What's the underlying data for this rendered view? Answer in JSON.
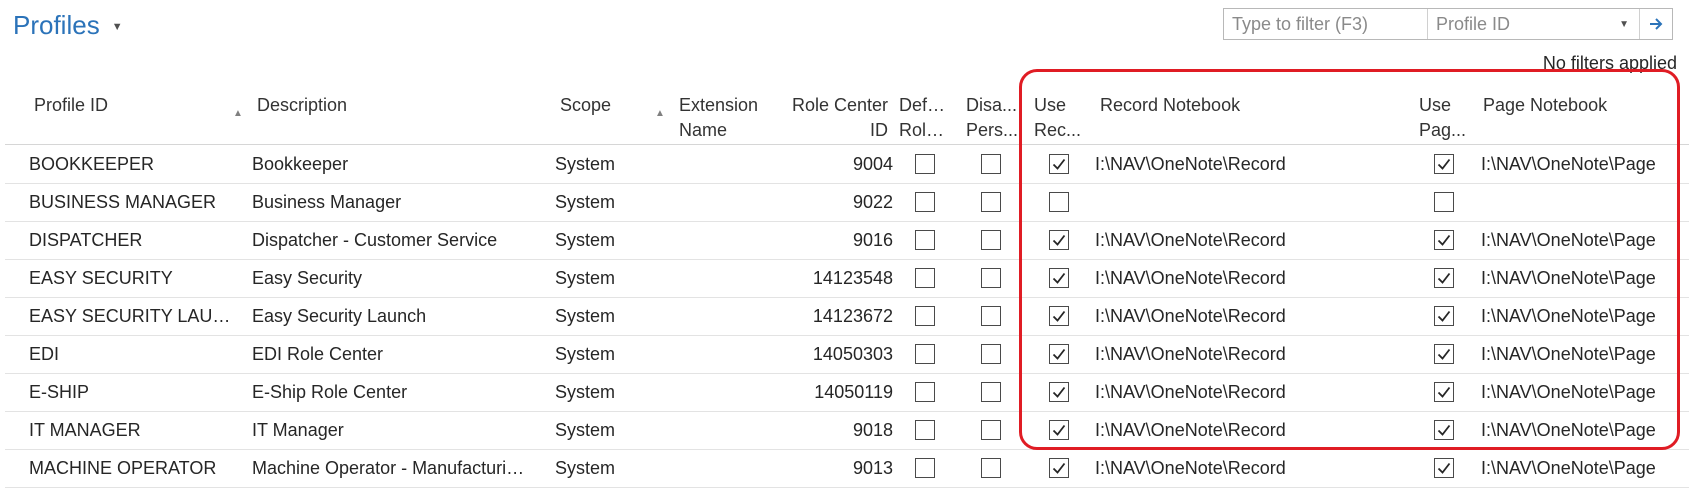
{
  "page": {
    "title": "Profiles",
    "filter": {
      "placeholder": "Type to filter (F3)",
      "field": "Profile ID",
      "status": "No filters applied"
    }
  },
  "columns": [
    {
      "key": "profile_id",
      "label": "Profile ID"
    },
    {
      "key": "description",
      "label": "Description"
    },
    {
      "key": "scope",
      "label": "Scope"
    },
    {
      "key": "extension_name",
      "label": "Extension Name"
    },
    {
      "key": "role_center_id",
      "label": "Role Center ID"
    },
    {
      "key": "default_role",
      "label": "Defa... Role..."
    },
    {
      "key": "disable_pers",
      "label": "Disa... Pers..."
    },
    {
      "key": "use_record",
      "label": "Use Rec..."
    },
    {
      "key": "record_notebook",
      "label": "Record Notebook"
    },
    {
      "key": "use_page",
      "label": "Use Pag..."
    },
    {
      "key": "page_notebook",
      "label": "Page Notebook"
    }
  ],
  "column_header_lines": {
    "profile_id": [
      "Profile ID"
    ],
    "description": [
      "Description"
    ],
    "scope": [
      "Scope"
    ],
    "extension_name": [
      "Extension",
      "Name"
    ],
    "role_center_id": [
      "Role Center",
      "ID"
    ],
    "default_role": [
      "Defa...",
      "Role..."
    ],
    "disable_pers": [
      "Disa...",
      "Pers..."
    ],
    "use_record": [
      "Use",
      "Rec..."
    ],
    "record_notebook": [
      "Record Notebook"
    ],
    "use_page": [
      "Use",
      "Pag..."
    ],
    "page_notebook": [
      "Page Notebook"
    ]
  },
  "rows": [
    {
      "profile_id": "BOOKKEEPER",
      "description": "Bookkeeper",
      "scope": "System",
      "extension_name": "",
      "role_center_id": "9004",
      "default_role": false,
      "disable_pers": false,
      "use_record": true,
      "record_notebook": "I:\\NAV\\OneNote\\Record",
      "use_page": true,
      "page_notebook": "I:\\NAV\\OneNote\\Page"
    },
    {
      "profile_id": "BUSINESS MANAGER",
      "description": "Business Manager",
      "scope": "System",
      "extension_name": "",
      "role_center_id": "9022",
      "default_role": false,
      "disable_pers": false,
      "use_record": false,
      "record_notebook": "",
      "use_page": false,
      "page_notebook": ""
    },
    {
      "profile_id": "DISPATCHER",
      "description": "Dispatcher - Customer Service",
      "scope": "System",
      "extension_name": "",
      "role_center_id": "9016",
      "default_role": false,
      "disable_pers": false,
      "use_record": true,
      "record_notebook": "I:\\NAV\\OneNote\\Record",
      "use_page": true,
      "page_notebook": "I:\\NAV\\OneNote\\Page"
    },
    {
      "profile_id": "EASY SECURITY",
      "description": "Easy Security",
      "scope": "System",
      "extension_name": "",
      "role_center_id": "14123548",
      "default_role": false,
      "disable_pers": false,
      "use_record": true,
      "record_notebook": "I:\\NAV\\OneNote\\Record",
      "use_page": true,
      "page_notebook": "I:\\NAV\\OneNote\\Page"
    },
    {
      "profile_id": "EASY SECURITY LAUNCH",
      "description": "Easy Security Launch",
      "scope": "System",
      "extension_name": "",
      "role_center_id": "14123672",
      "default_role": false,
      "disable_pers": false,
      "use_record": true,
      "record_notebook": "I:\\NAV\\OneNote\\Record",
      "use_page": true,
      "page_notebook": "I:\\NAV\\OneNote\\Page"
    },
    {
      "profile_id": "EDI",
      "description": "EDI Role Center",
      "scope": "System",
      "extension_name": "",
      "role_center_id": "14050303",
      "default_role": false,
      "disable_pers": false,
      "use_record": true,
      "record_notebook": "I:\\NAV\\OneNote\\Record",
      "use_page": true,
      "page_notebook": "I:\\NAV\\OneNote\\Page"
    },
    {
      "profile_id": "E-SHIP",
      "description": "E-Ship Role Center",
      "scope": "System",
      "extension_name": "",
      "role_center_id": "14050119",
      "default_role": false,
      "disable_pers": false,
      "use_record": true,
      "record_notebook": "I:\\NAV\\OneNote\\Record",
      "use_page": true,
      "page_notebook": "I:\\NAV\\OneNote\\Page"
    },
    {
      "profile_id": "IT MANAGER",
      "description": "IT Manager",
      "scope": "System",
      "extension_name": "",
      "role_center_id": "9018",
      "default_role": false,
      "disable_pers": false,
      "use_record": true,
      "record_notebook": "I:\\NAV\\OneNote\\Record",
      "use_page": true,
      "page_notebook": "I:\\NAV\\OneNote\\Page"
    },
    {
      "profile_id": "MACHINE OPERATOR",
      "description": "Machine Operator - Manufacturing ...",
      "scope": "System",
      "extension_name": "",
      "role_center_id": "9013",
      "default_role": false,
      "disable_pers": false,
      "use_record": true,
      "record_notebook": "I:\\NAV\\OneNote\\Record",
      "use_page": true,
      "page_notebook": "I:\\NAV\\OneNote\\Page"
    }
  ],
  "icons": {
    "title_caret": "chevron-down-icon",
    "filter_dropdown": "chevron-down-icon",
    "filter_go": "arrow-right-icon",
    "sort_indicator": "sort-up-icon",
    "checkmark": "checkmark-icon"
  },
  "colors": {
    "title": "#2b73b9",
    "highlight": "#e01c24",
    "go_arrow": "#2b73b9"
  }
}
